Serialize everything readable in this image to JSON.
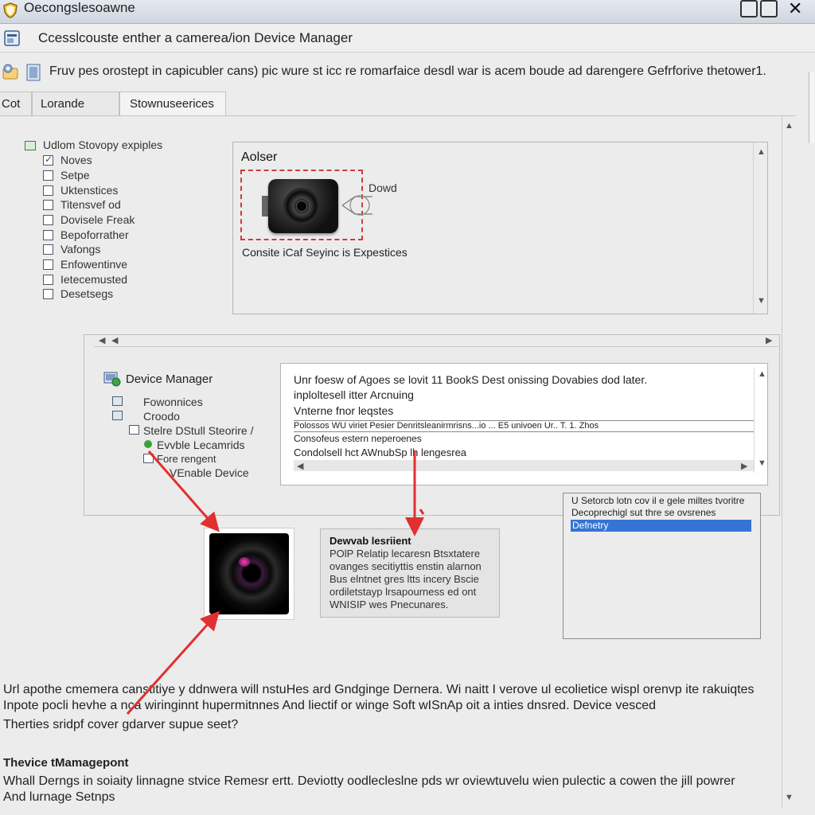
{
  "window": {
    "title": "Oecongslesoawne",
    "controls": [
      "minimize",
      "maximize",
      "close"
    ],
    "close_glyph": "✕"
  },
  "header": {
    "text": "Ccesslcouste enther a camereа/ion Device Manager"
  },
  "description": {
    "text": "Fruv pes orostept in capicubler cans) pic wure st icc re romarfaice desdl war is acem boude ad darengere Gefrforive thetower1."
  },
  "tabs": [
    {
      "label": "Cot",
      "active": false
    },
    {
      "label": "Lorande",
      "active": false
    },
    {
      "label": "Stownuseerices",
      "active": true
    }
  ],
  "checklist": {
    "root_label": "Udlom Stovopy expiples",
    "items": [
      {
        "label": "Noves",
        "checked": true
      },
      {
        "label": "Setpe",
        "checked": false
      },
      {
        "label": "Uktenstices",
        "checked": false
      },
      {
        "label": "Titensvef od",
        "checked": false
      },
      {
        "label": "Dovisele Freak",
        "checked": false
      },
      {
        "label": "Bepoforrather",
        "checked": false
      },
      {
        "label": "Vafongs",
        "checked": false
      },
      {
        "label": "Enfowentinve",
        "checked": false
      },
      {
        "label": "Ietecemusted",
        "checked": false
      },
      {
        "label": "Desetsegs",
        "checked": false
      }
    ]
  },
  "properties": {
    "title": "Aolser",
    "callout": "Dowd",
    "caption": "Consite iCaf Seyinc is Expestices"
  },
  "device_manager": {
    "title": "Device Manager",
    "nodes": [
      "Fowonnices",
      "Croodo",
      "Stelre DStull Steorire /",
      "Evvble Lecamrids",
      "Fore rengent",
      "VEnable Device"
    ]
  },
  "details": {
    "line1": "Unr foesw of Agoes se lovit 11 BookS Dest onissing Dovabies dod later.",
    "line2": "inploltesell itter Arcnuing",
    "line3": "Vnterne fnor leqstes",
    "row1": "Polossos WU viriet Pesier Denritsleanirmrisns...io ... E5  univoen  Ur.. T. 1. Zhos",
    "row2": "Consofeus estern neperoenes",
    "row3": "Condolsell hct AWnubSp lh lengesrea"
  },
  "notes": {
    "title": "Dewvab lesriient",
    "lines": [
      "POlP Relatip lecaresn Btsxtatere",
      "ovanges secitiyttis enstin alarnon",
      "Bus elntnet gres ltts incery Bscie",
      "ordiletstayp lrsapourness ed ont",
      "WNISIP wes Pnecunares."
    ]
  },
  "dropdown": {
    "line1": "U Setorcb lotn cov il e gele miltes tvoritre",
    "line2": "Decoprechigl sut thre se ovsrenes",
    "selected": "Defnetry"
  },
  "body": {
    "para1": [
      "Url apothe cmemera canstitiye y ddnwera will nstuHes ard Gndginge Dernera. Wi naitt I verove ul ecolietice wispl orenvp ite rakuiqtes",
      "Inpote pocli hevhe a nca wiringinnt hupermitnnes And liectif or winge Soft wISnAp oit a inties dnsred.   Device vesced",
      "Therties sridpf cover gdarver supue seet?"
    ],
    "heading": "Thevice tMamagepont",
    "para2": [
      "Whall Derngs in soiaity linnagne stvice Remesr ertt. Deviotty oodlecleslne pds wr oviewtuvelu wien pulectic a cowen the jill powrer",
      "And lurnage Setnps"
    ]
  },
  "colors": {
    "accent": "#3574d4",
    "annotation_red": "#e03030",
    "highlight_dashed": "#d23a3a"
  }
}
